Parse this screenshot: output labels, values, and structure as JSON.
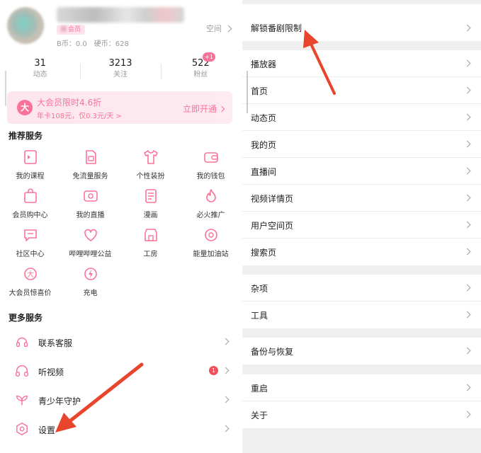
{
  "profile": {
    "vip_tag": "会员",
    "bcoin": "B币：0.0",
    "coin": "硬币：628",
    "space_link": "空间"
  },
  "stats": [
    {
      "value": "31",
      "label": "动态"
    },
    {
      "value": "3213",
      "label": "关注"
    },
    {
      "value": "522",
      "label": "粉丝"
    }
  ],
  "fan_badge": "+1",
  "vip_banner": {
    "badge": "大",
    "title": "大会员限时4.6折",
    "subtitle": "年卡108元，仅0.3元/天 >",
    "action": "立即开通"
  },
  "recommended": {
    "title": "推荐服务",
    "items": [
      {
        "label": "我的课程",
        "icon": "course-icon"
      },
      {
        "label": "免流量服务",
        "icon": "sim-card-icon"
      },
      {
        "label": "个性装扮",
        "icon": "shirt-icon"
      },
      {
        "label": "我的钱包",
        "icon": "wallet-icon"
      },
      {
        "label": "会员购中心",
        "icon": "shopping-bag-icon"
      },
      {
        "label": "我的直播",
        "icon": "live-tv-icon"
      },
      {
        "label": "漫画",
        "icon": "comic-icon"
      },
      {
        "label": "必火推广",
        "icon": "fire-icon"
      },
      {
        "label": "社区中心",
        "icon": "chat-bubble-icon"
      },
      {
        "label": "哔哩哔哩公益",
        "icon": "heart-hands-icon"
      },
      {
        "label": "工房",
        "icon": "shop-icon"
      },
      {
        "label": "能量加油站",
        "icon": "energy-icon"
      },
      {
        "label": "大会员惊喜价",
        "icon": "vip-coin-icon"
      },
      {
        "label": "充电",
        "icon": "lightning-icon"
      }
    ]
  },
  "more": {
    "title": "更多服务",
    "items": [
      {
        "label": "联系客服",
        "icon": "headset-icon"
      },
      {
        "label": "听视频",
        "icon": "headphones-icon",
        "badge": "1"
      },
      {
        "label": "青少年守护",
        "icon": "sprout-icon"
      },
      {
        "label": "设置",
        "icon": "gear-icon"
      }
    ]
  },
  "settings": {
    "groups": [
      [
        "解锁番剧限制"
      ],
      [
        "播放器",
        "首页",
        "动态页",
        "我的页",
        "直播间",
        "视频详情页",
        "用户空间页",
        "搜索页"
      ],
      [
        "杂项",
        "工具"
      ],
      [
        "备份与恢复"
      ],
      [
        "重启",
        "关于"
      ]
    ]
  },
  "colors": {
    "accent": "#fb7299",
    "arrow": "#e8452c",
    "background": "#f0f0f0"
  }
}
